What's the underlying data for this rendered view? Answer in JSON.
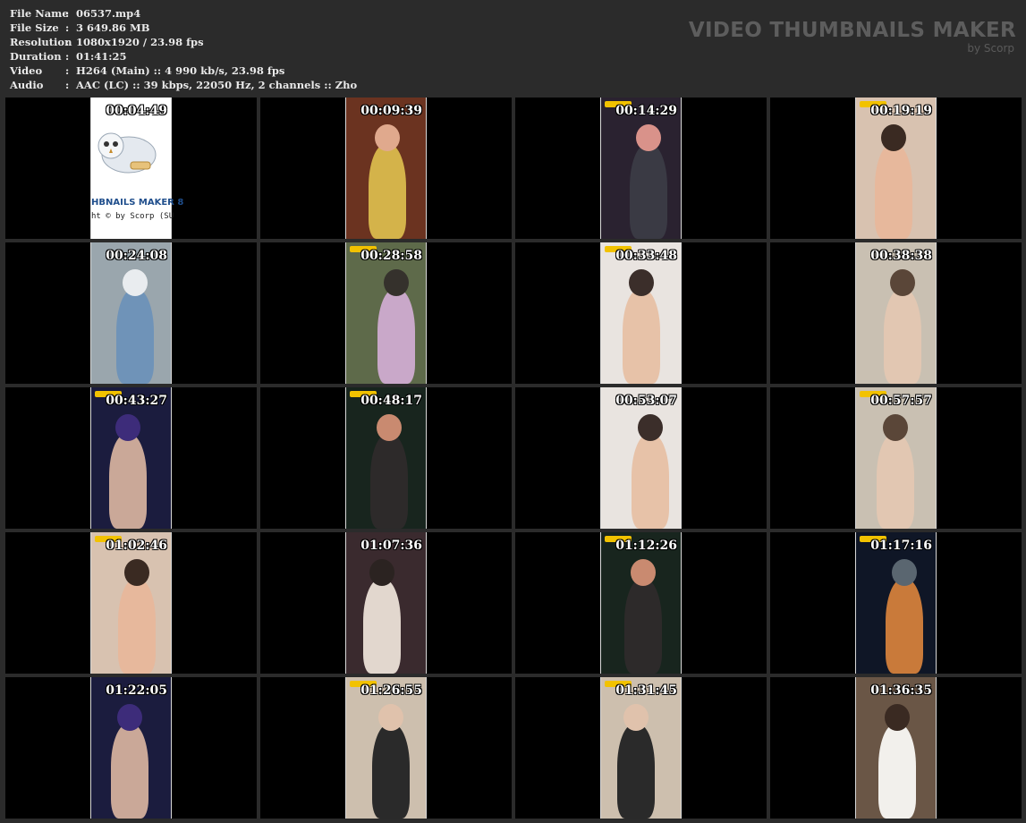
{
  "meta": [
    {
      "key": "File Name",
      "value": "06537.mp4"
    },
    {
      "key": "File Size",
      "value": "3 649.86 MB"
    },
    {
      "key": "Resolution",
      "value": "1080x1920 / 23.98 fps"
    },
    {
      "key": "Duration",
      "value": "01:41:25"
    },
    {
      "key": "Video",
      "value": "H264 (Main) :: 4 990 kb/s, 23.98 fps"
    },
    {
      "key": "Audio",
      "value": "AAC (LC) :: 39 kbps, 22050 Hz, 2 channels :: Zho"
    }
  ],
  "separator": ":",
  "brand": {
    "title": "VIDEO THUMBNAILS MAKER",
    "subtitle": "by Scorp"
  },
  "first_frame": {
    "title": "HBNAILS MAKER 8",
    "copyright": "ht © by Scorp (SU"
  },
  "thumbnails": [
    {
      "time": "00:04:49",
      "theme": "logo"
    },
    {
      "time": "00:09:39",
      "theme": "warm"
    },
    {
      "time": "00:14:29",
      "theme": "social"
    },
    {
      "time": "00:19:19",
      "theme": "skin"
    },
    {
      "time": "00:24:08",
      "theme": "bath"
    },
    {
      "time": "00:28:58",
      "theme": "street"
    },
    {
      "time": "00:33:48",
      "theme": "bright"
    },
    {
      "time": "00:38:38",
      "theme": "room"
    },
    {
      "time": "00:43:27",
      "theme": "club"
    },
    {
      "time": "00:48:17",
      "theme": "dark"
    },
    {
      "time": "00:53:07",
      "theme": "bright"
    },
    {
      "time": "00:57:57",
      "theme": "room"
    },
    {
      "time": "01:02:46",
      "theme": "skin"
    },
    {
      "time": "01:07:36",
      "theme": "shop"
    },
    {
      "time": "01:12:26",
      "theme": "dark"
    },
    {
      "time": "01:17:16",
      "theme": "night"
    },
    {
      "time": "01:22:05",
      "theme": "club"
    },
    {
      "time": "01:26:55",
      "theme": "wall"
    },
    {
      "time": "01:31:45",
      "theme": "wall"
    },
    {
      "time": "01:36:35",
      "theme": "hall"
    }
  ],
  "themes": {
    "logo": {
      "bg": "#ffffff",
      "fig": "#e9ecef",
      "head": "#d7dde3"
    },
    "warm": {
      "bg": "#6b3320",
      "fig": "#d4b34a",
      "head": "#e0a98d"
    },
    "social": {
      "bg": "#2a2230",
      "fig": "#3a3a44",
      "head": "#d9928a"
    },
    "skin": {
      "bg": "#d8c2b0",
      "fig": "#e7b89c",
      "head": "#3a2a22"
    },
    "bath": {
      "bg": "#9aa6ad",
      "fig": "#6f93b8",
      "head": "#e9ecef"
    },
    "street": {
      "bg": "#5e6a4a",
      "fig": "#c9a8c9",
      "head": "#35312c"
    },
    "bright": {
      "bg": "#e9e4e0",
      "fig": "#e7c2a8",
      "head": "#3b2e2a"
    },
    "room": {
      "bg": "#c9c0b2",
      "fig": "#e2c7b2",
      "head": "#5a4638"
    },
    "club": {
      "bg": "#1b1c3e",
      "fig": "#caa898",
      "head": "#3d2c7a"
    },
    "dark": {
      "bg": "#18251e",
      "fig": "#2d2a2a",
      "head": "#c98a70"
    },
    "shop": {
      "bg": "#3a2a2e",
      "fig": "#e2d7ce",
      "head": "#2b2321"
    },
    "night": {
      "bg": "#0f1626",
      "fig": "#c97a3a",
      "head": "#5a6670"
    },
    "wall": {
      "bg": "#cdbfae",
      "fig": "#2a2a2a",
      "head": "#e0c2ac"
    },
    "hall": {
      "bg": "#6a5646",
      "fig": "#f2f0ec",
      "head": "#3a2a22"
    }
  }
}
